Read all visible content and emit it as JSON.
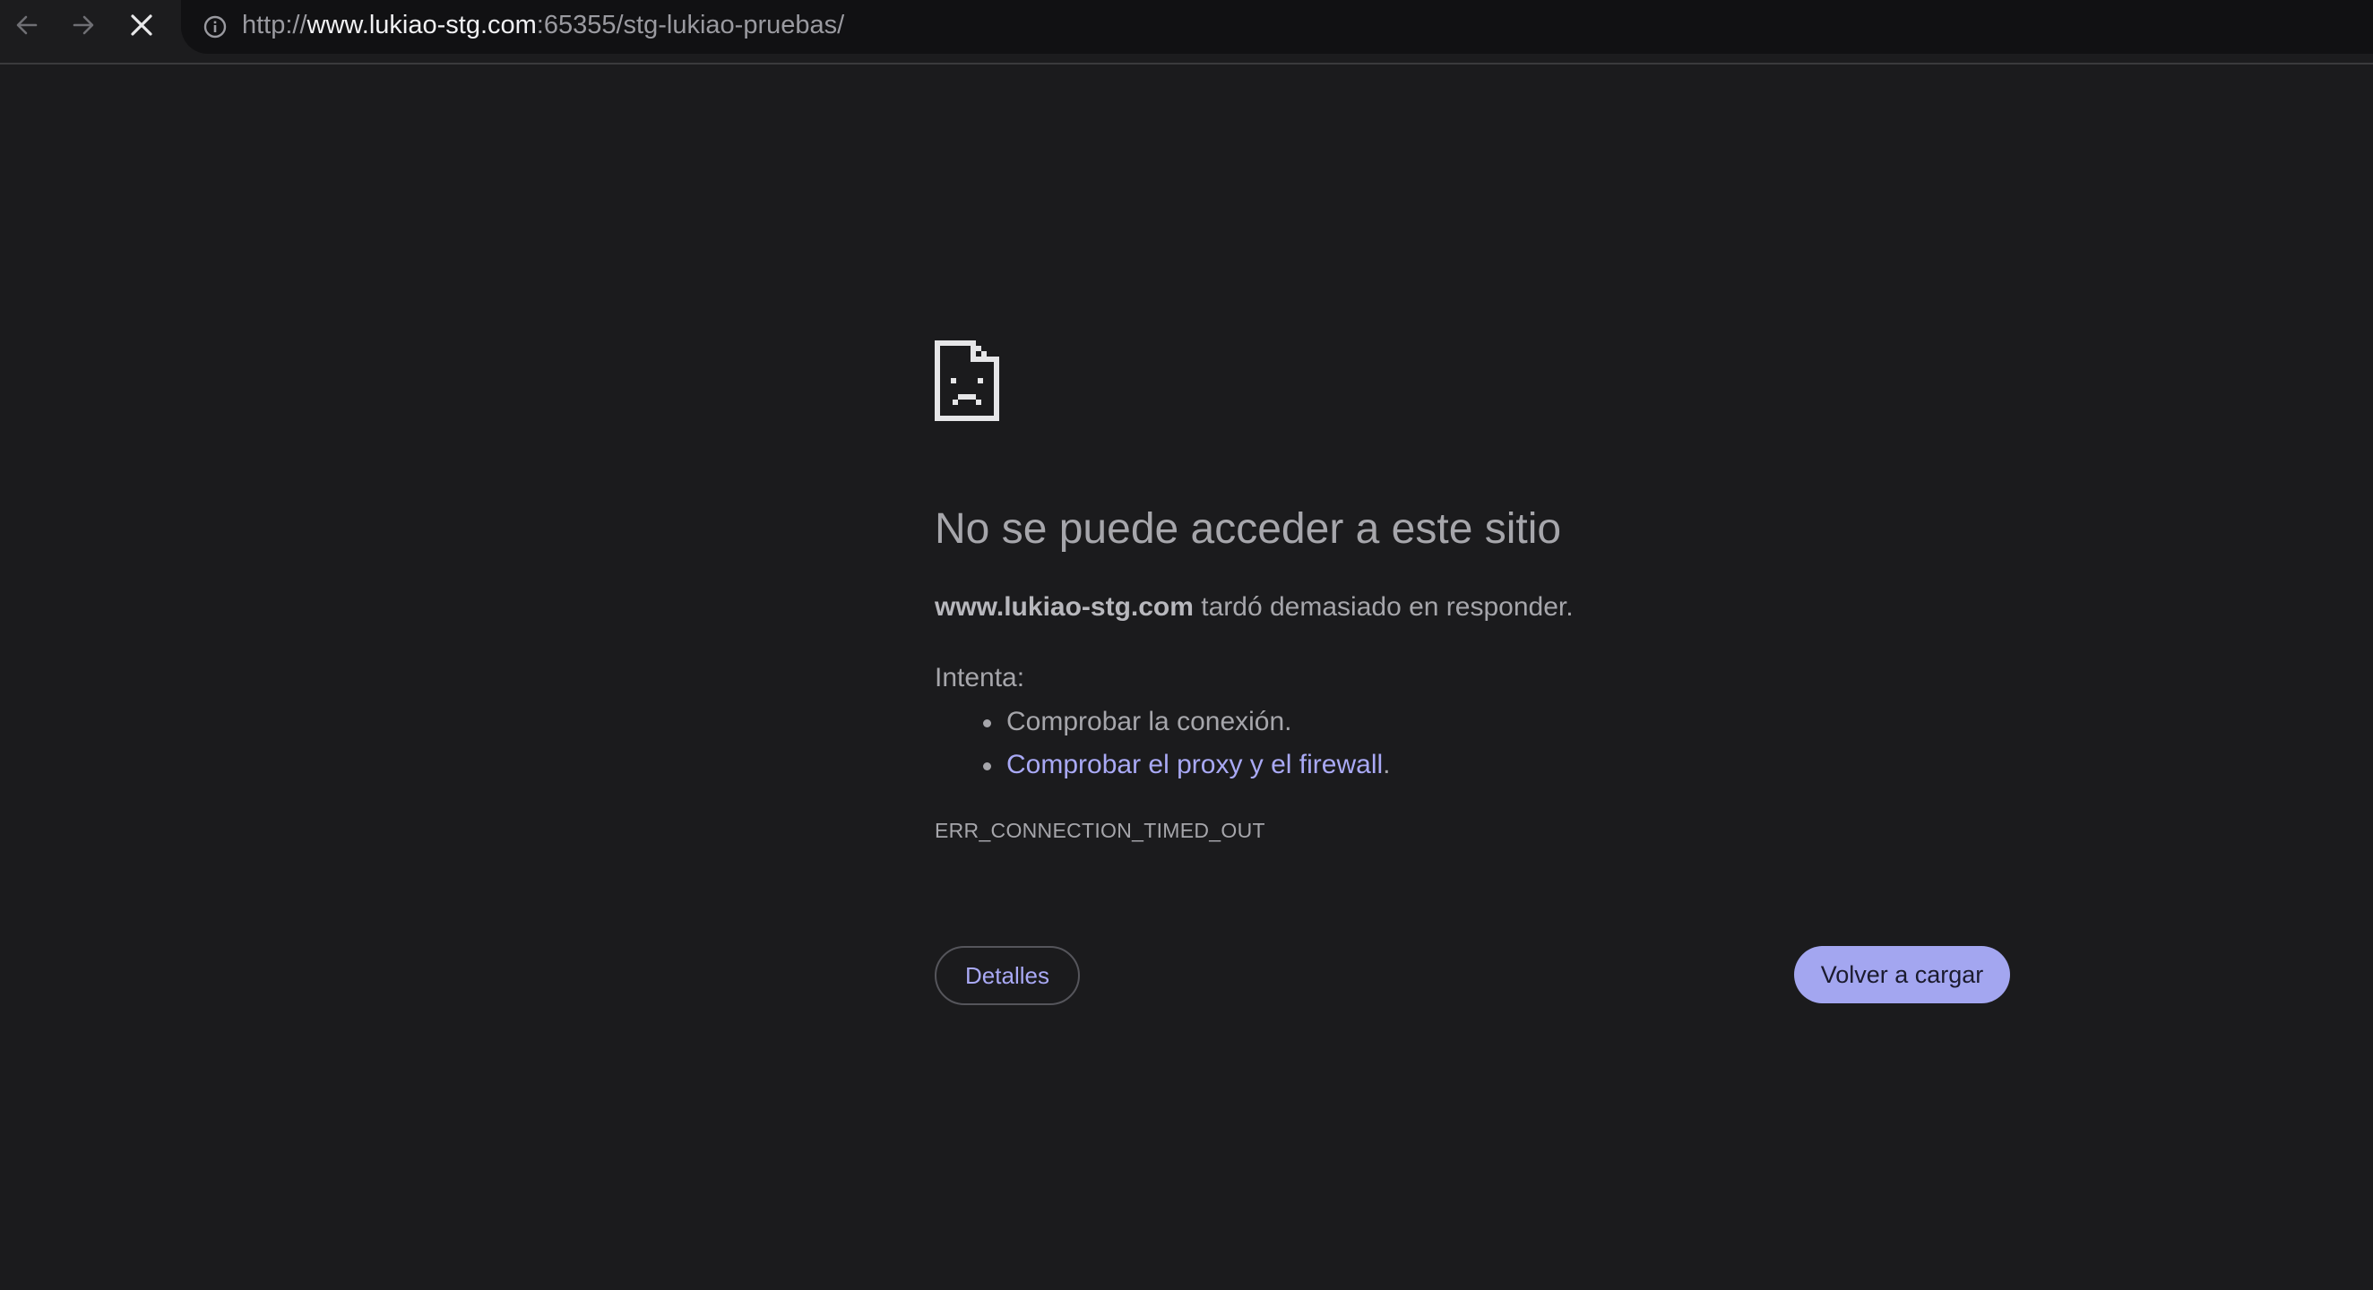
{
  "browser": {
    "url": {
      "scheme": "http://",
      "host": "www.lukiao-stg.com",
      "rest": ":65355/stg-lukiao-pruebas/"
    },
    "icons": {
      "back": "back-arrow-icon",
      "forward": "forward-arrow-icon",
      "stop": "stop-loading-icon",
      "info": "site-info-icon"
    }
  },
  "error_page": {
    "icon": "sad-document-icon",
    "title": "No se puede acceder a este sitio",
    "summary": {
      "host": "www.lukiao-stg.com",
      "message": " tardó demasiado en responder."
    },
    "try_label": "Intenta:",
    "suggestions": [
      {
        "text": "Comprobar la conexión."
      },
      {
        "link_text": "Comprobar el proxy y el firewall",
        "suffix": "."
      }
    ],
    "error_code": "ERR_CONNECTION_TIMED_OUT",
    "details_label": "Detalles",
    "reload_label": "Volver a cargar"
  },
  "colors": {
    "background": "#1b1b1d",
    "link": "#a9a9f5",
    "primary_button": "#a3a6f0",
    "text": "#a6a6ab"
  }
}
